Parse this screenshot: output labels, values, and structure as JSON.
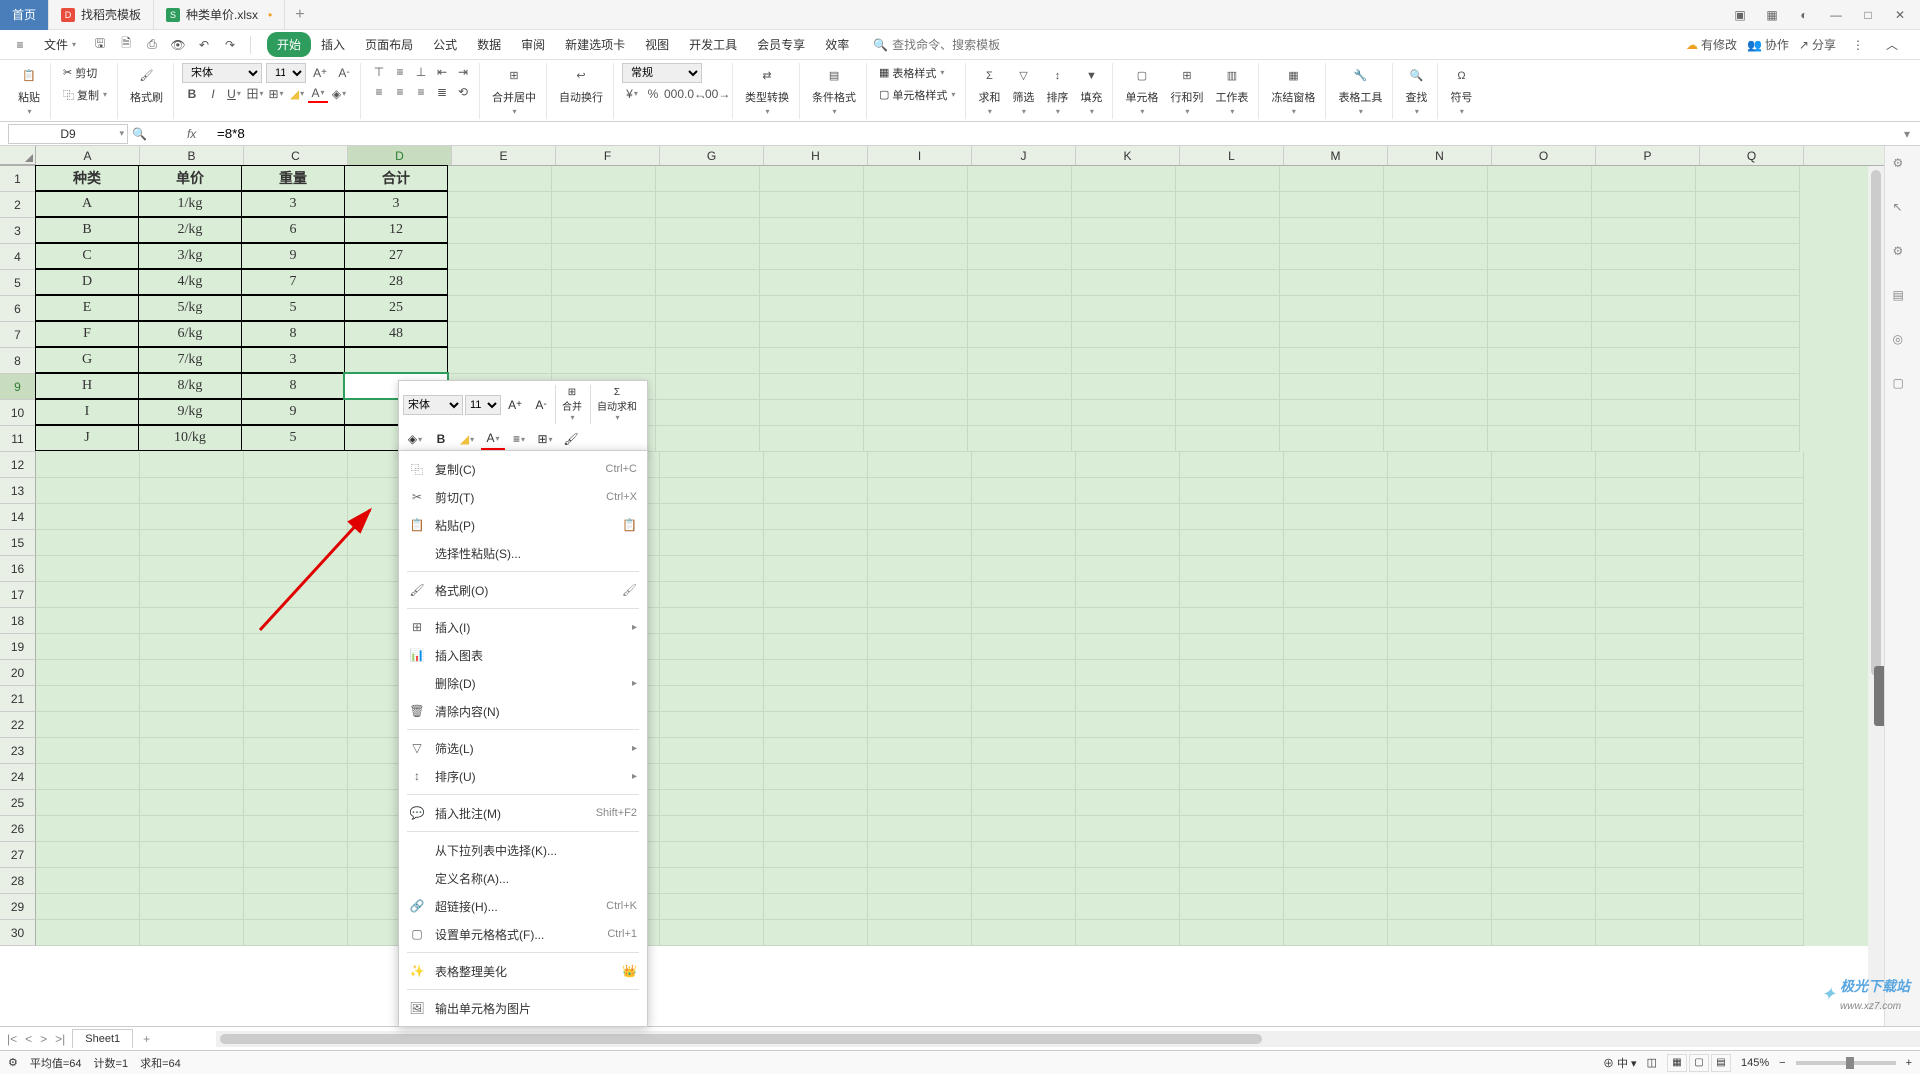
{
  "titlebar": {
    "home_tab": "首页",
    "tab2_label": "找稻壳模板",
    "tab3_label": "种类单价.xlsx",
    "tab3_modified": "•"
  },
  "menubar": {
    "file": "文件",
    "tabs": [
      "开始",
      "插入",
      "页面布局",
      "公式",
      "数据",
      "审阅",
      "新建选项卡",
      "视图",
      "开发工具",
      "会员专享",
      "效率"
    ],
    "search_placeholder": "查找命令、搜索模板",
    "right": {
      "changes": "有修改",
      "collab": "协作",
      "share": "分享"
    }
  },
  "ribbon": {
    "paste": "粘贴",
    "cut": "剪切",
    "copy": "复制",
    "format_painter": "格式刷",
    "font_name": "宋体",
    "font_size": "11",
    "merge_center": "合并居中",
    "auto_wrap": "自动换行",
    "number_format": "常规",
    "type_convert": "类型转换",
    "cond_fmt": "条件格式",
    "table_style": "表格样式",
    "cell_style": "单元格样式",
    "sum": "求和",
    "filter": "筛选",
    "sort": "排序",
    "fill": "填充",
    "cell": "单元格",
    "row_col": "行和列",
    "worksheet": "工作表",
    "freeze": "冻结窗格",
    "table_tool": "表格工具",
    "find": "查找",
    "symbol": "符号"
  },
  "formulabar": {
    "cell_ref": "D9",
    "formula": "=8*8"
  },
  "grid": {
    "columns": [
      "A",
      "B",
      "C",
      "D",
      "E",
      "F",
      "G",
      "H",
      "I",
      "J",
      "K",
      "L",
      "M",
      "N",
      "O",
      "P",
      "Q"
    ],
    "rows_visible": 30,
    "selected_col": "D",
    "selected_row": 9,
    "header_row": [
      "种类",
      "单价",
      "重量",
      "合计"
    ],
    "data_rows": [
      [
        "A",
        "1/kg",
        "3",
        "3"
      ],
      [
        "B",
        "2/kg",
        "6",
        "12"
      ],
      [
        "C",
        "3/kg",
        "9",
        "27"
      ],
      [
        "D",
        "4/kg",
        "7",
        "28"
      ],
      [
        "E",
        "5/kg",
        "5",
        "25"
      ],
      [
        "F",
        "6/kg",
        "8",
        "48"
      ],
      [
        "G",
        "7/kg",
        "3",
        ""
      ],
      [
        "H",
        "8/kg",
        "8",
        ""
      ],
      [
        "I",
        "9/kg",
        "9",
        ""
      ],
      [
        "J",
        "10/kg",
        "5",
        ""
      ]
    ]
  },
  "mini_toolbar": {
    "font": "宋体",
    "size": "11",
    "merge": "合并",
    "autosum": "自动求和"
  },
  "context_menu": {
    "items": [
      {
        "icon": "copy",
        "label": "复制(C)",
        "shortcut": "Ctrl+C"
      },
      {
        "icon": "cut",
        "label": "剪切(T)",
        "shortcut": "Ctrl+X"
      },
      {
        "icon": "paste",
        "label": "粘贴(P)",
        "right_icon": "clipboard"
      },
      {
        "label": "选择性粘贴(S)..."
      },
      {
        "sep": true
      },
      {
        "icon": "brush",
        "label": "格式刷(O)",
        "right_icon": "brush"
      },
      {
        "sep": true
      },
      {
        "icon": "insert",
        "label": "插入(I)",
        "submenu": true
      },
      {
        "icon": "chart",
        "label": "插入图表"
      },
      {
        "label": "删除(D)",
        "submenu": true
      },
      {
        "icon": "clear",
        "label": "清除内容(N)"
      },
      {
        "sep": true
      },
      {
        "icon": "filter",
        "label": "筛选(L)",
        "submenu": true
      },
      {
        "icon": "sort",
        "label": "排序(U)",
        "submenu": true
      },
      {
        "sep": true
      },
      {
        "icon": "comment",
        "label": "插入批注(M)",
        "shortcut": "Shift+F2"
      },
      {
        "sep": true
      },
      {
        "label": "从下拉列表中选择(K)..."
      },
      {
        "label": "定义名称(A)..."
      },
      {
        "icon": "link",
        "label": "超链接(H)...",
        "shortcut": "Ctrl+K"
      },
      {
        "icon": "fmt",
        "label": "设置单元格格式(F)...",
        "shortcut": "Ctrl+1"
      },
      {
        "sep": true
      },
      {
        "icon": "beautify",
        "label": "表格整理美化",
        "right_icon": "crown"
      },
      {
        "sep": true
      },
      {
        "icon": "export",
        "label": "输出单元格为图片"
      }
    ]
  },
  "sheetbar": {
    "sheet1": "Sheet1"
  },
  "statusbar": {
    "avg": "平均值=64",
    "count": "计数=1",
    "sum": "求和=64",
    "ime": "中",
    "zoom": "145%"
  },
  "watermark": {
    "brand": "极光下载站",
    "url": "www.xz7.com"
  }
}
